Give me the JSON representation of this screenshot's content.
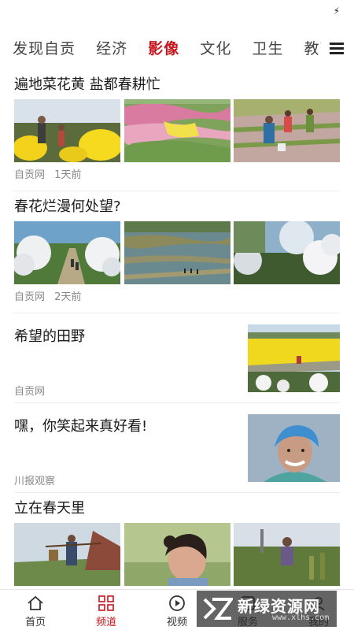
{
  "tabs": [
    "发现自贡",
    "经济",
    "影像",
    "文化",
    "卫生",
    "教育"
  ],
  "active_tab": "影像",
  "articles": [
    {
      "title": "遍地菜花黄 盐都春耕忙",
      "source": "自贡网",
      "time": "1天前"
    },
    {
      "title": "春花烂漫何处望?",
      "source": "自贡网",
      "time": "2天前"
    },
    {
      "title": "希望的田野",
      "source": "自贡网"
    },
    {
      "title": "嘿，你笑起来真好看!",
      "source": "川报观察"
    },
    {
      "title": "立在春天里"
    }
  ],
  "nav": [
    {
      "label": "首页",
      "icon": "home-icon"
    },
    {
      "label": "频道",
      "icon": "grid-icon"
    },
    {
      "label": "视频",
      "icon": "play-icon"
    },
    {
      "label": "服务",
      "icon": "service-icon"
    },
    {
      "label": "我的",
      "icon": "profile-icon"
    }
  ],
  "watermark": {
    "title": "新绿资源网",
    "sub": "www.xlhs.com"
  },
  "colors": {
    "accent": "#c8161d",
    "meta": "#888888",
    "divider": "#ececec"
  }
}
